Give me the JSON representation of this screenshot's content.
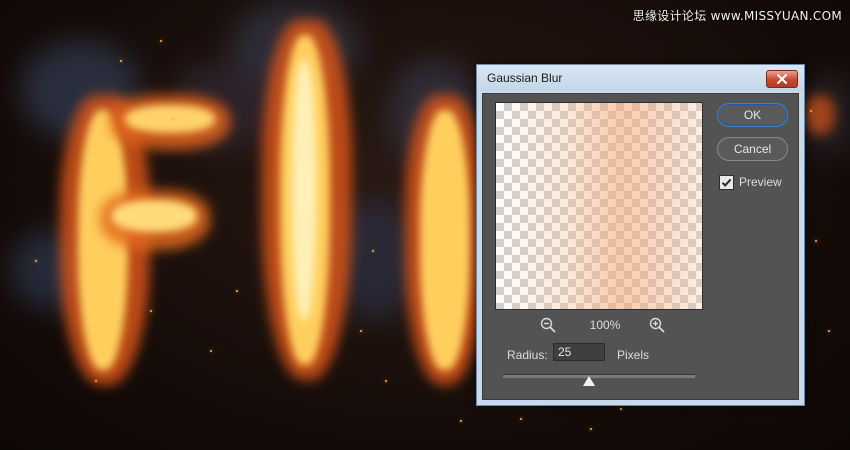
{
  "watermark": {
    "text": "思缘设计论坛 www.MISSYUAN.COM"
  },
  "dialog": {
    "title": "Gaussian Blur",
    "ok_label": "OK",
    "cancel_label": "Cancel",
    "preview_label": "Preview",
    "preview_checked": true,
    "zoom_level": "100%",
    "radius_label": "Radius:",
    "radius_value": "25",
    "radius_units": "Pixels",
    "radius_slider_fraction": 0.45
  },
  "icons": {
    "close": "close-icon",
    "zoom_out": "zoom-out-icon",
    "zoom_in": "zoom-in-icon",
    "check": "checkmark-icon"
  },
  "colors": {
    "dialog_body": "#535353",
    "title_bar": "#c8d9ea",
    "close_button": "#c9482f",
    "ok_outline": "#3a84d6",
    "fire_core": "#ffd36b",
    "fire_outer": "#e4611c"
  }
}
